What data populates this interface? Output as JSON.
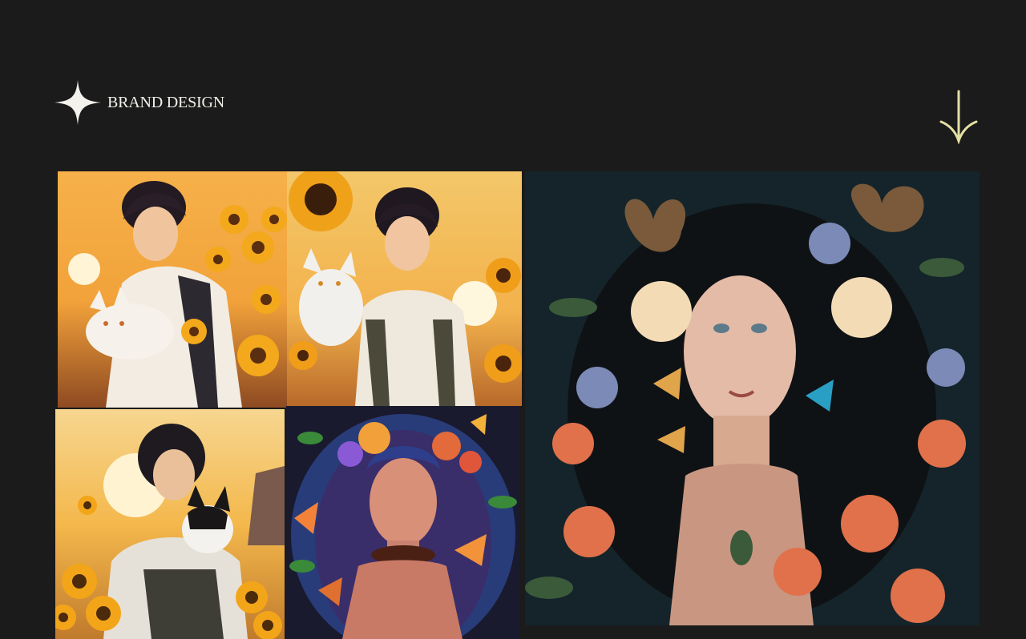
{
  "brand": {
    "title": "BRAND DESIGN",
    "logo_icon": "sparkle-star-icon"
  },
  "nav": {
    "scroll_icon": "arrow-down-icon"
  },
  "gallery": {
    "items": [
      {
        "subject": "anime-boy-white-cat-sunflowers"
      },
      {
        "subject": "anime-girl-white-cat-sunflowers"
      },
      {
        "subject": "anime-girl-black-white-kitten-sunflowers"
      },
      {
        "subject": "girl-blue-hair-flowers-butterflies"
      },
      {
        "subject": "girl-dark-curly-hair-butterflies-flowers"
      }
    ]
  },
  "colors": {
    "background": "#1b1b1b",
    "text": "#f2f0ea",
    "accent_arrow": "#e4e0a4"
  }
}
